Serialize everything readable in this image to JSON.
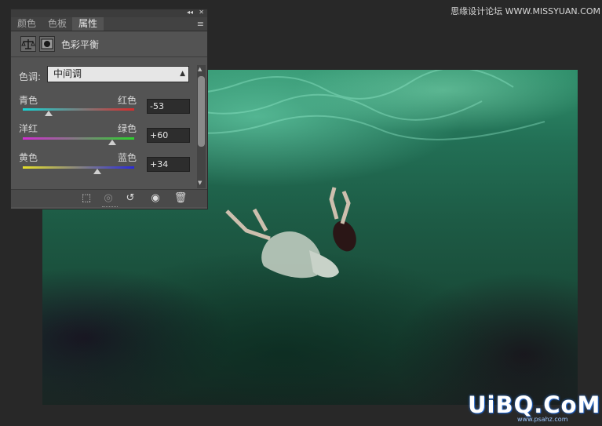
{
  "watermark_top": "思缘设计论坛  WWW.MISSYUAN.COM",
  "watermark_logo": "UiBQ.CoM",
  "watermark_sub": "www.psahz.com",
  "panel": {
    "tabs": [
      {
        "label": "颜色",
        "active": false
      },
      {
        "label": "色板",
        "active": false
      },
      {
        "label": "属性",
        "active": true
      }
    ],
    "title": "色彩平衡",
    "tone_label": "色调:",
    "tone_value": "中间调",
    "sliders": [
      {
        "left": "青色",
        "right": "红色",
        "value": "-53",
        "fraction": 0.235,
        "gradient": [
          "#14d6d6",
          "#d82c2c"
        ]
      },
      {
        "left": "洋红",
        "right": "绿色",
        "value": "+60",
        "fraction": 0.8,
        "gradient": [
          "#d22cd2",
          "#2cd22c"
        ]
      },
      {
        "left": "黄色",
        "right": "蓝色",
        "value": "+34",
        "fraction": 0.67,
        "gradient": [
          "#e6e02a",
          "#2a2ad8"
        ]
      }
    ],
    "icons": {
      "adjustment": "balance-scale-icon",
      "mask": "mask-icon",
      "clip": "clip-to-layer-icon",
      "visibility_prev": "view-previous-icon",
      "reset": "reset-icon",
      "toggle_visibility": "eye-icon",
      "delete": "trash-icon",
      "collapse": "collapse-icon",
      "close": "close-icon",
      "menu": "panel-menu-icon"
    }
  }
}
